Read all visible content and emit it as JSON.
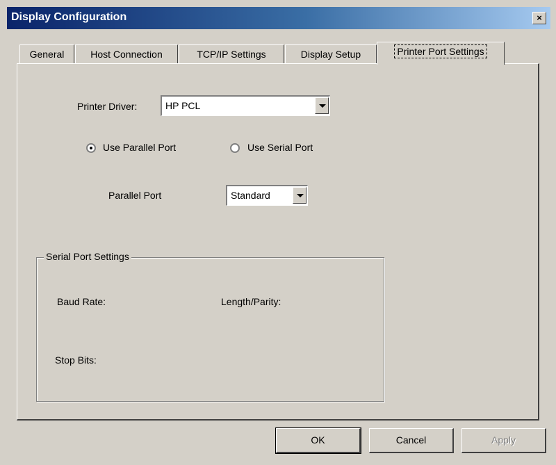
{
  "window": {
    "title": "Display Configuration",
    "close_glyph": "×"
  },
  "tabs": [
    {
      "label": "General"
    },
    {
      "label": "Host Connection"
    },
    {
      "label": "TCP/IP Settings"
    },
    {
      "label": "Display Setup"
    },
    {
      "label": "Printer Port Settings",
      "active": true
    }
  ],
  "printer": {
    "driver_label": "Printer Driver:",
    "driver_value": "HP PCL",
    "parallel_option": "Use Parallel Port",
    "serial_option": "Use Serial Port",
    "selected_port": "parallel",
    "parallel_port_label": "Parallel Port",
    "parallel_port_value": "Standard"
  },
  "serial_group": {
    "title": "Serial Port Settings",
    "baud_rate_label": "Baud Rate:",
    "length_parity_label": "Length/Parity:",
    "stop_bits_label": "Stop Bits:"
  },
  "buttons": {
    "ok": "OK",
    "cancel": "Cancel",
    "apply": "Apply",
    "apply_enabled": false
  },
  "icons": {
    "close": "close-icon",
    "dropdown": "chevron-down-icon",
    "radio": "radio-icon"
  }
}
